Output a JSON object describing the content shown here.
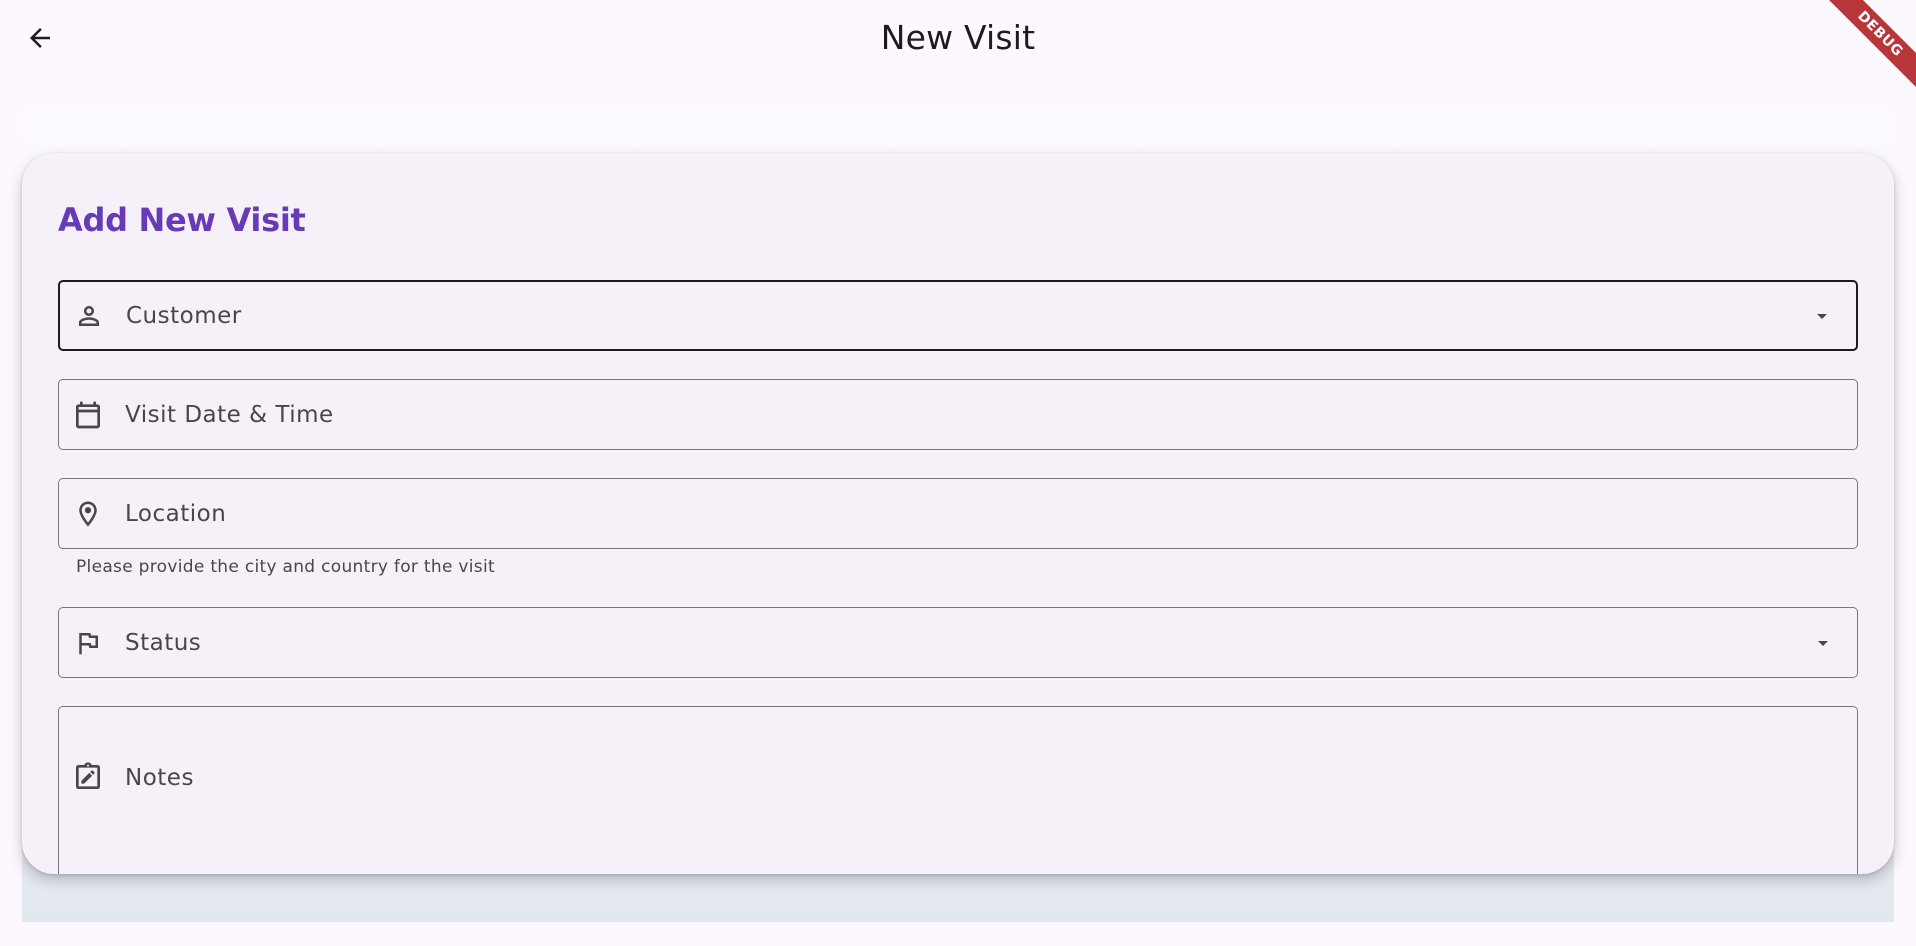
{
  "appbar": {
    "title": "New Visit",
    "back_icon": "arrow-back-icon",
    "debug_banner": "DEBUG"
  },
  "form": {
    "heading": "Add New Visit",
    "fields": {
      "customer": {
        "label": "Customer",
        "icon": "person-icon",
        "type": "dropdown"
      },
      "visit_date": {
        "label": "Visit Date & Time",
        "icon": "calendar-icon",
        "type": "text"
      },
      "location": {
        "label": "Location",
        "icon": "location-pin-icon",
        "type": "text",
        "helper": "Please provide the city and country for the visit"
      },
      "status": {
        "label": "Status",
        "icon": "flag-icon",
        "type": "dropdown"
      },
      "notes": {
        "label": "Notes",
        "icon": "edit-note-icon",
        "type": "textarea"
      }
    }
  },
  "colors": {
    "background": "#fdf7fe",
    "card": "#f6f1f8",
    "heading_accent": "#673ab7",
    "outline": "#7a757f",
    "debug_ribbon": "#b8353a"
  }
}
